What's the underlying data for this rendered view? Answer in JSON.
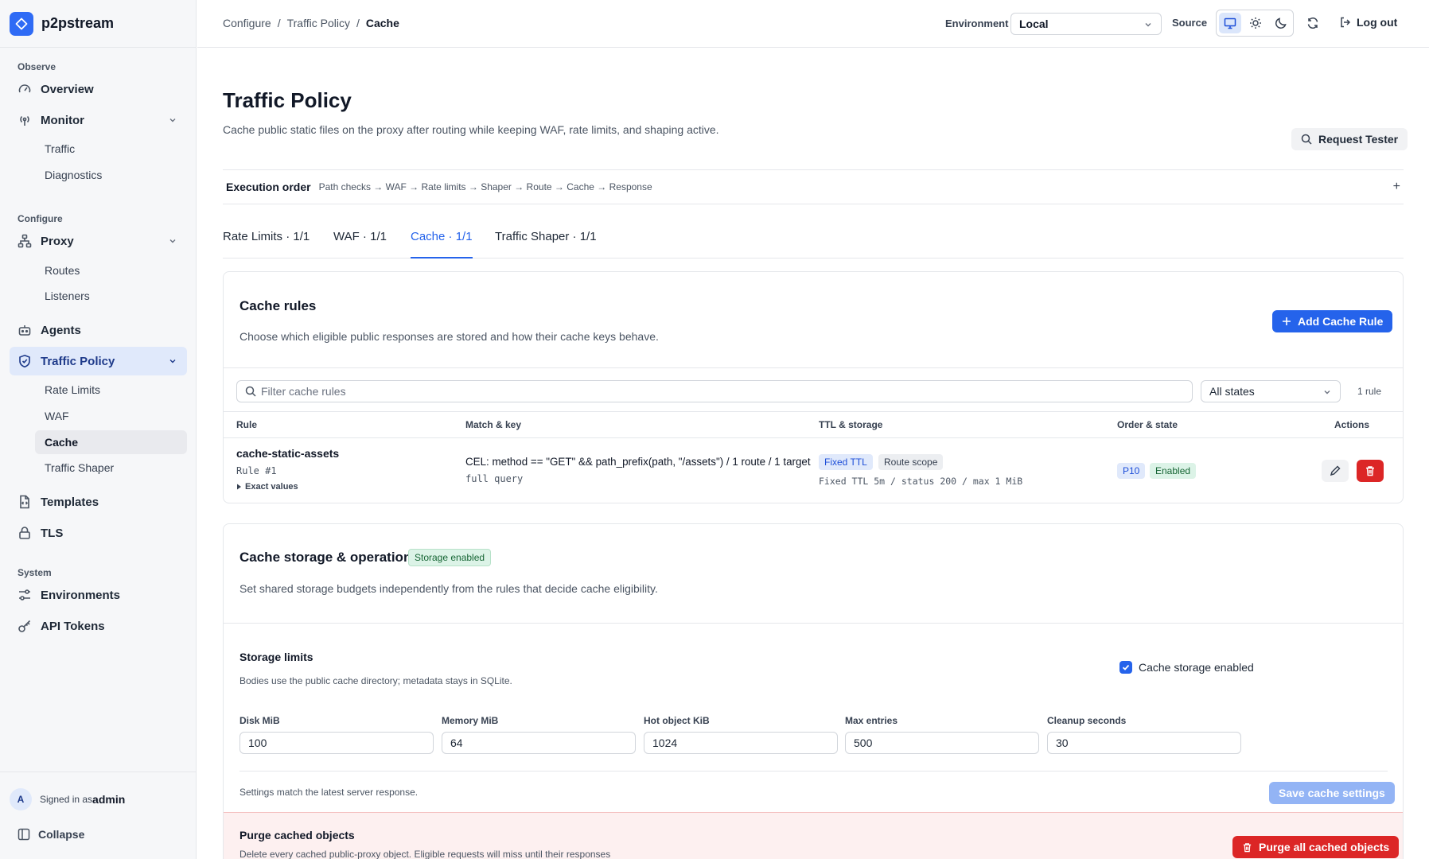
{
  "brand": {
    "name": "p2pstream"
  },
  "sidebar": {
    "sections": {
      "observe": "Observe",
      "configure": "Configure",
      "system": "System"
    },
    "overview": "Overview",
    "monitor": "Monitor",
    "traffic": "Traffic",
    "diagnostics": "Diagnostics",
    "proxy": "Proxy",
    "routes": "Routes",
    "listeners": "Listeners",
    "agents": "Agents",
    "traffic_policy": "Traffic Policy",
    "rate_limits": "Rate Limits",
    "waf": "WAF",
    "cache": "Cache",
    "traffic_shaper": "Traffic Shaper",
    "templates": "Templates",
    "tls": "TLS",
    "environments": "Environments",
    "api_tokens": "API Tokens",
    "user_initial": "A",
    "signed_in_as": "Signed in as",
    "user": "admin",
    "collapse": "Collapse"
  },
  "header": {
    "breadcrumb": [
      "Configure",
      "Traffic Policy",
      "Cache"
    ],
    "separator": "/",
    "environment_label": "Environment",
    "environment_value": "Local",
    "source_label": "Source",
    "logout": "Log out"
  },
  "page": {
    "title": "Traffic Policy",
    "description": "Cache public static files on the proxy after routing while keeping WAF, rate limits, and shaping active.",
    "request_tester": "Request Tester",
    "execution_label": "Execution order",
    "execution_order": "Path checks → WAF → Rate limits → Shaper → Route → Cache → Response",
    "expand_symbol": "+",
    "tabs": [
      "Rate Limits · 1/1",
      "WAF · 1/1",
      "Cache · 1/1",
      "Traffic Shaper · 1/1"
    ]
  },
  "cache_rules": {
    "title": "Cache rules",
    "description": "Choose which eligible public responses are stored and how their cache keys behave.",
    "add_button": "Add Cache Rule",
    "filter_placeholder": "Filter cache rules",
    "state_filter": "All states",
    "count": "1 rule",
    "columns": [
      "Rule",
      "Match & key",
      "TTL & storage",
      "Order & state",
      "Actions"
    ],
    "rows": [
      {
        "name": "cache-static-assets",
        "id": "Rule #1",
        "exact": "Exact values",
        "match": "CEL: method == \"GET\" && path_prefix(path, \"/assets\") / 1 route / 1 target",
        "key": "full query",
        "ttl_badge": "Fixed TTL",
        "scope_badge": "Route scope",
        "storage": "Fixed TTL 5m / status 200 / max 1 MiB",
        "priority": "P10",
        "state": "Enabled"
      }
    ]
  },
  "storage": {
    "title": "Cache storage & operations",
    "status_badge": "Storage enabled",
    "description": "Set shared storage budgets independently from the rules that decide cache eligibility.",
    "limits_title": "Storage limits",
    "limits_desc": "Bodies use the public cache directory; metadata stays in SQLite.",
    "enabled_label": "Cache storage enabled",
    "enabled": true,
    "fields": [
      {
        "label": "Disk MiB",
        "value": "100"
      },
      {
        "label": "Memory MiB",
        "value": "64"
      },
      {
        "label": "Hot object KiB",
        "value": "1024"
      },
      {
        "label": "Max entries",
        "value": "500"
      },
      {
        "label": "Cleanup seconds",
        "value": "30"
      }
    ],
    "sync_status": "Settings match the latest server response.",
    "save_button": "Save cache settings"
  },
  "purge": {
    "title": "Purge cached objects",
    "description": "Delete every cached public-proxy object. Eligible requests will miss until their responses",
    "button": "Purge all cached objects"
  }
}
